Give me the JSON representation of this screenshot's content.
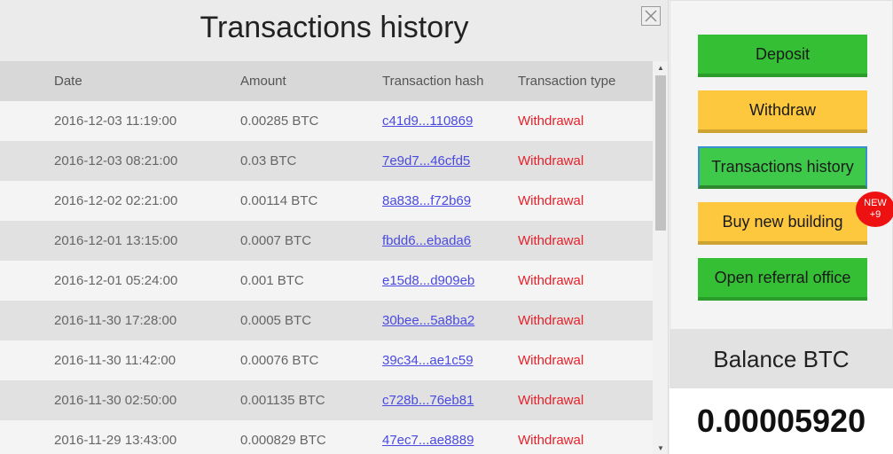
{
  "modal": {
    "title": "Transactions history",
    "columns": {
      "date": "Date",
      "amount": "Amount",
      "hash": "Transaction hash",
      "type": "Transaction type"
    },
    "rows": [
      {
        "date": "2016-12-03 11:19:00",
        "amount": "0.00285 BTC",
        "hash": "c41d9...110869",
        "type": "Withdrawal"
      },
      {
        "date": "2016-12-03 08:21:00",
        "amount": "0.03 BTC",
        "hash": "7e9d7...46cfd5",
        "type": "Withdrawal"
      },
      {
        "date": "2016-12-02 02:21:00",
        "amount": "0.00114 BTC",
        "hash": "8a838...f72b69",
        "type": "Withdrawal"
      },
      {
        "date": "2016-12-01 13:15:00",
        "amount": "0.0007 BTC",
        "hash": "fbdd6...ebada6",
        "type": "Withdrawal"
      },
      {
        "date": "2016-12-01 05:24:00",
        "amount": "0.001 BTC",
        "hash": "e15d8...d909eb",
        "type": "Withdrawal"
      },
      {
        "date": "2016-11-30 17:28:00",
        "amount": "0.0005 BTC",
        "hash": "30bee...5a8ba2",
        "type": "Withdrawal"
      },
      {
        "date": "2016-11-30 11:42:00",
        "amount": "0.00076 BTC",
        "hash": "39c34...ae1c59",
        "type": "Withdrawal"
      },
      {
        "date": "2016-11-30 02:50:00",
        "amount": "0.001135 BTC",
        "hash": "c728b...76eb81",
        "type": "Withdrawal"
      },
      {
        "date": "2016-11-29 13:43:00",
        "amount": "0.000829 BTC",
        "hash": "47ec7...ae8889",
        "type": "Withdrawal"
      }
    ],
    "close_icon": "close-icon"
  },
  "sidebar": {
    "deposit_label": "Deposit",
    "withdraw_label": "Withdraw",
    "history_label": "Transactions history",
    "buy_building_label": "Buy new building",
    "referral_label": "Open referral office",
    "badge": {
      "line1": "NEW",
      "line2": "+9"
    },
    "balance_label": "Balance BTC",
    "balance_value": "0.00005920"
  },
  "colors": {
    "green_button": "#34bf34",
    "yellow_button": "#fdc73e",
    "withdrawal_text": "#e8202a",
    "hash_link": "#4a4ae0",
    "badge": "#ee1111"
  }
}
